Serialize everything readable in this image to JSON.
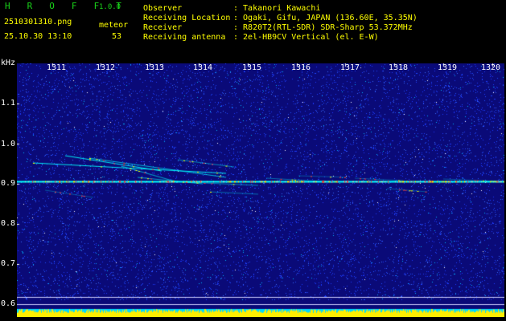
{
  "header": {
    "app_title": "H R O F F T",
    "version": "1.0.0",
    "filename": "2510301310.png",
    "datetime": "25.10.30 13:10",
    "meteor_label": "meteor",
    "meteor_count": "53"
  },
  "station_info": [
    {
      "label": "Observer",
      "value": ": Takanori Kawachi"
    },
    {
      "label": "Receiving Location",
      "value": ": Ogaki, Gifu, JAPAN (136.60E, 35.35N)"
    },
    {
      "label": "Receiver",
      "value": ": R820T2(RTL-SDR) SDR-Sharp 53.372MHz"
    },
    {
      "label": "Receiving antenna",
      "value": ": 2el-HB9CV Vertical (el. E-W)"
    }
  ],
  "spectrogram": {
    "y_unit": "kHz",
    "y_ticks": [
      "1.1",
      "1.0",
      "0.9",
      "0.8",
      "0.7",
      "0.6"
    ],
    "x_ticks": [
      "1311",
      "1312",
      "1313",
      "1314",
      "1315",
      "1316",
      "1317",
      "1318",
      "1319",
      "1320"
    ],
    "carrier_khz": 0.905,
    "background_color": "#0a0a78",
    "noise_colors": [
      "#1e3cff",
      "#2050ff",
      "#3a6bff",
      "#00b4ff",
      "#ffffff"
    ],
    "signal_colors": [
      "#00ffff",
      "#ffff00",
      "#ff3030"
    ],
    "level_bar_color": "#ffee00",
    "level_bar_base_color": "#00d8ff"
  }
}
